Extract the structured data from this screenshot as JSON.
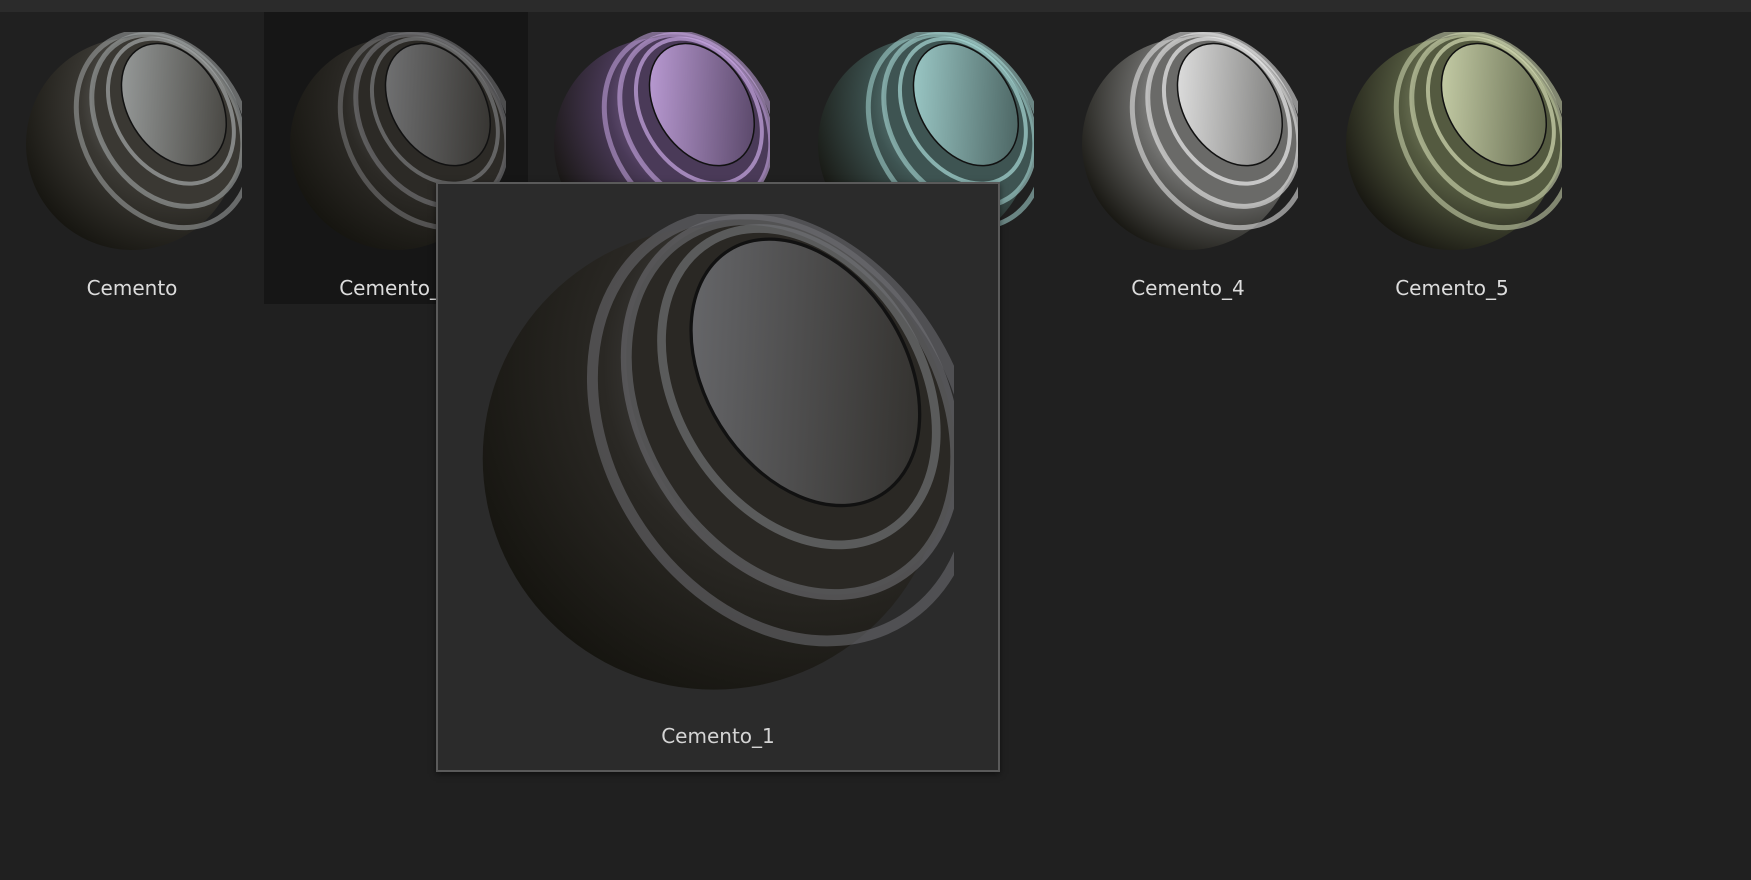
{
  "materials": [
    {
      "label": "Cemento",
      "light": "#a4a8a8",
      "dark": "#3a3833",
      "selected": false
    },
    {
      "label": "Cemento_1",
      "light": "#7b7c7e",
      "dark": "#2c2a26",
      "selected": true
    },
    {
      "label": "",
      "light": "#c9a8e4",
      "dark": "#4a3a58",
      "selected": false
    },
    {
      "label": "",
      "light": "#a8d8d6",
      "dark": "#3e5452",
      "selected": false
    },
    {
      "label": "Cemento_4",
      "light": "#eeeeee",
      "dark": "#6a6a68",
      "selected": false
    },
    {
      "label": "Cemento_5",
      "light": "#d4dcb4",
      "dark": "#545a40",
      "selected": false
    }
  ],
  "preview": {
    "label": "Cemento_1",
    "light": "#6f7074",
    "dark": "#2a2824"
  }
}
